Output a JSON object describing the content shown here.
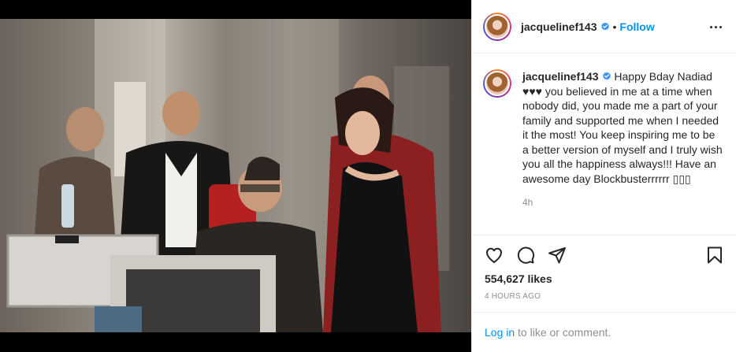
{
  "post": {
    "photo_alt": "",
    "author": {
      "username": "jacquelinef143",
      "verified": true,
      "follow_label": "Follow",
      "separator": "•"
    },
    "caption": {
      "username": "jacquelinef143",
      "text": "Happy Bday Nadiad ♥♥♥ you believed in me at a time when nobody did, you made me a part of your family and supported me when I needed it the most! You keep inspiring me to be a better version of myself and I truly wish you all the happiness always!!! Have an awesome day Blockbusterrrrrr ▯▯▯",
      "relative_time": "4h"
    },
    "actions": {
      "like_icon": "heart-icon",
      "comment_icon": "comment-icon",
      "share_icon": "share-icon",
      "save_icon": "bookmark-icon"
    },
    "likes_label": "554,627 likes",
    "timestamp": "4 HOURS AGO",
    "login_prompt": {
      "link": "Log in",
      "rest": " to like or comment."
    }
  },
  "colors": {
    "accent": "#0095f6",
    "verified": "#3897f0",
    "text": "#262626",
    "muted": "#8e8e8e",
    "border": "#efefef"
  }
}
